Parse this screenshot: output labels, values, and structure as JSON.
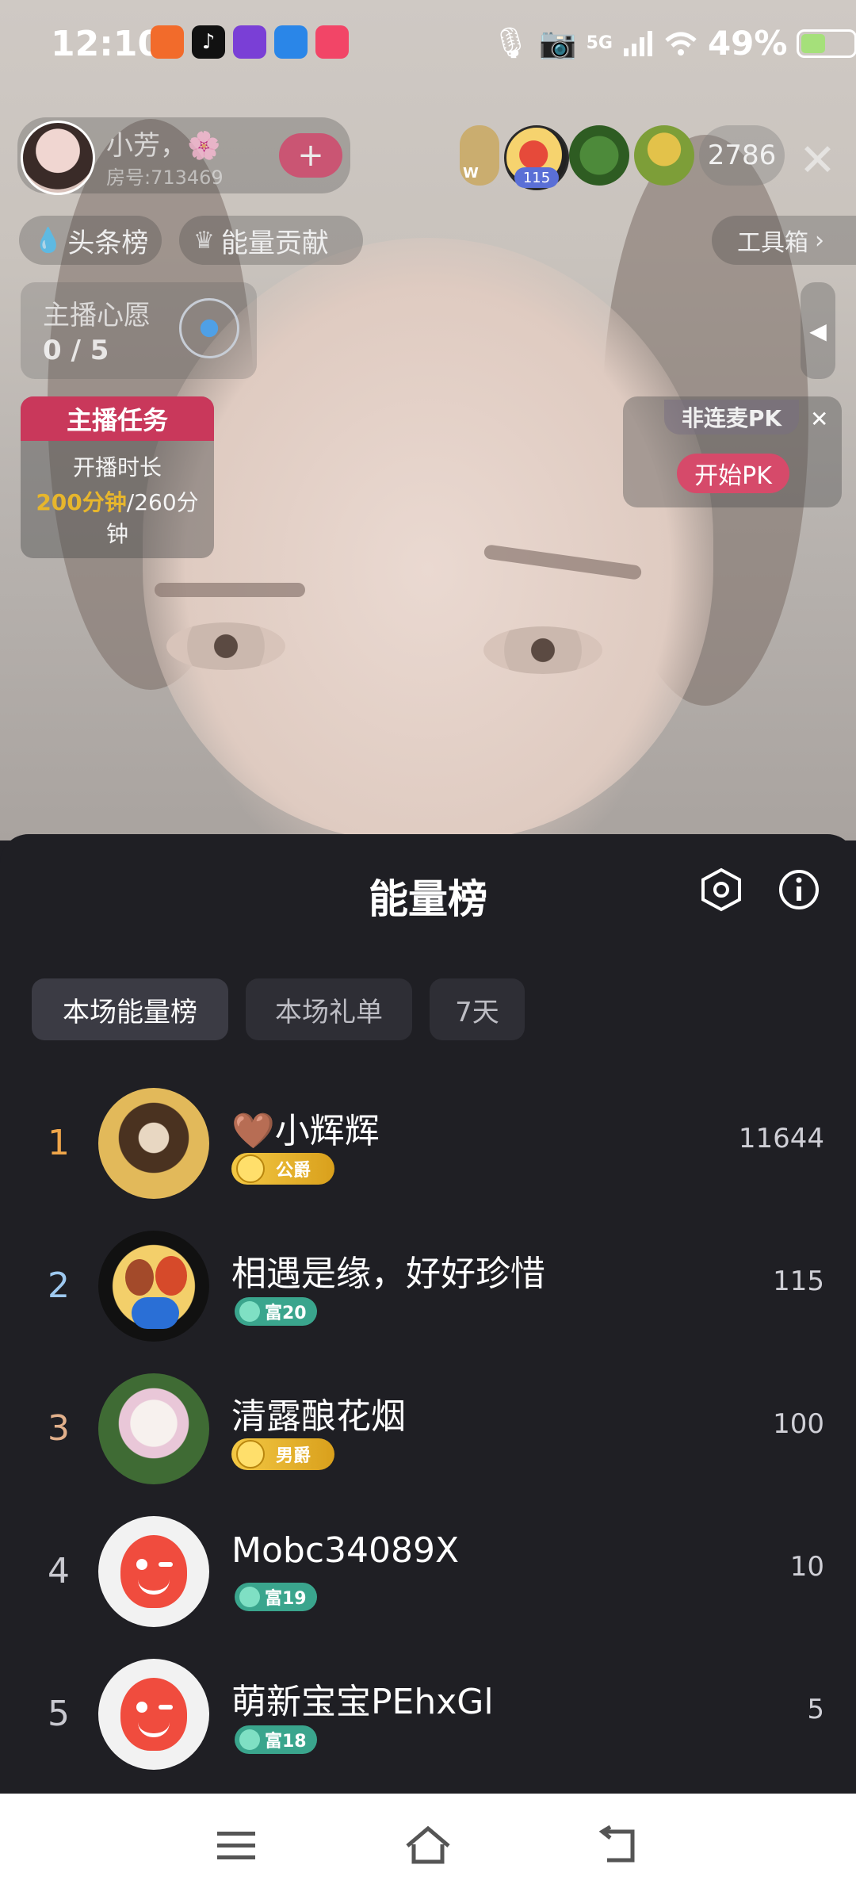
{
  "status_bar": {
    "time": "12:10",
    "battery": "49%",
    "network": "5G"
  },
  "host": {
    "name": "小芳，🌸",
    "room": "房号:713469",
    "follow_symbol": "+",
    "viewer_count": "2786",
    "viewer_badge": "115",
    "viewer_w_label": "W"
  },
  "top_tags": {
    "headline": "头条榜",
    "energy": "能量贡献",
    "toolbox": "工具箱"
  },
  "wish": {
    "title": "主播心愿",
    "progress": "0 / 5"
  },
  "task": {
    "title": "主播任务",
    "label": "开播时长",
    "current": "200分钟",
    "total_part1": "/260分",
    "total_part2": "钟"
  },
  "pk": {
    "label": "非连麦PK",
    "button": "开始PK"
  },
  "sheet": {
    "title": "能量榜",
    "tabs": [
      "本场能量榜",
      "本场礼单",
      "7天"
    ],
    "active_tab": 0
  },
  "rankings": [
    {
      "rank": "1",
      "name": "🤎小辉辉",
      "badge": "公爵",
      "badge_type": "gold",
      "score": "11644",
      "rank_color": "#f0a64a"
    },
    {
      "rank": "2",
      "name": "相遇是缘，好好珍惜",
      "badge": "富20",
      "badge_type": "teal",
      "score": "115",
      "rank_color": "#9ec9f0"
    },
    {
      "rank": "3",
      "name": "清露酿花烟",
      "badge": "男爵",
      "badge_type": "gold",
      "score": "100",
      "rank_color": "#e2b08b"
    },
    {
      "rank": "4",
      "name": "Mobc34089X",
      "badge": "富19",
      "badge_type": "teal",
      "score": "10",
      "rank_color": "#c9c9d0"
    },
    {
      "rank": "5",
      "name": "萌新宝宝PEhxGl",
      "badge": "富18",
      "badge_type": "teal",
      "score": "5",
      "rank_color": "#c9c9d0"
    }
  ],
  "colors": {
    "sheet_bg": "#1f1f24",
    "tab_active_bg": "#3b3b44",
    "tab_bg": "#2e2e35",
    "gold_badge": "#e7b62c",
    "teal_badge": "#3aa58d",
    "task_header": "#c9385b",
    "pk_button": "#d64a6a"
  }
}
